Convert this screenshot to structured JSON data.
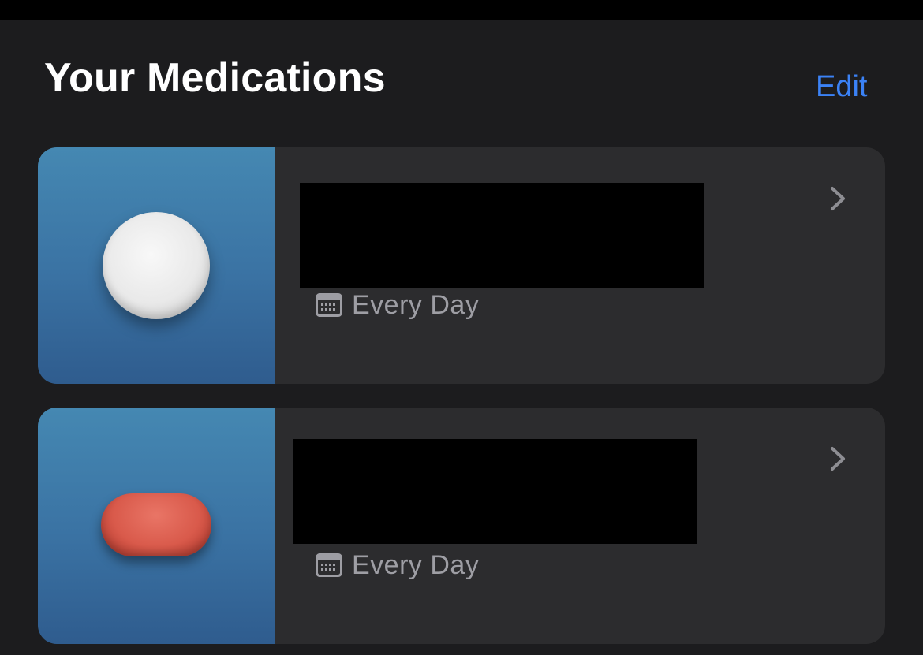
{
  "header": {
    "title": "Your Medications",
    "edit_label": "Edit"
  },
  "colors": {
    "background": "#1c1c1e",
    "card": "#2c2c2e",
    "accent": "#3b82f6",
    "thumb_top": "#4588b2",
    "thumb_bottom": "#2f5c8e",
    "pill_white": "#eeeeee",
    "pill_red": "#d95a4b"
  },
  "medications": [
    {
      "pill_icon": "white-round-pill-icon",
      "schedule": "Every Day"
    },
    {
      "pill_icon": "red-capsule-pill-icon",
      "schedule": "Every Day"
    }
  ]
}
